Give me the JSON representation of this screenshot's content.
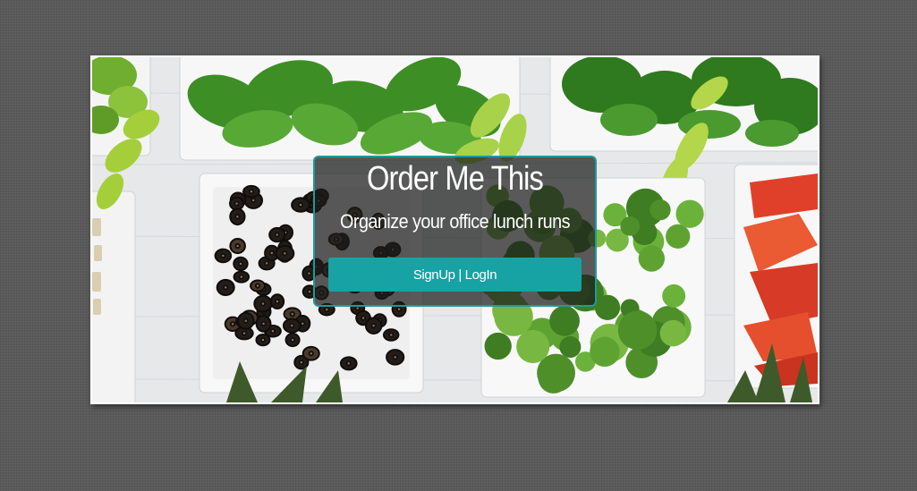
{
  "hero": {
    "title": "Order Me This",
    "subtitle": "Organize your office lunch runs",
    "cta_label": "SignUp | LogIn"
  },
  "colors": {
    "page_background": "#5a5a5a",
    "accent": "#17a2a3",
    "card_border": "#1f9a9a",
    "card_background": "rgba(28,28,28,0.72)"
  }
}
